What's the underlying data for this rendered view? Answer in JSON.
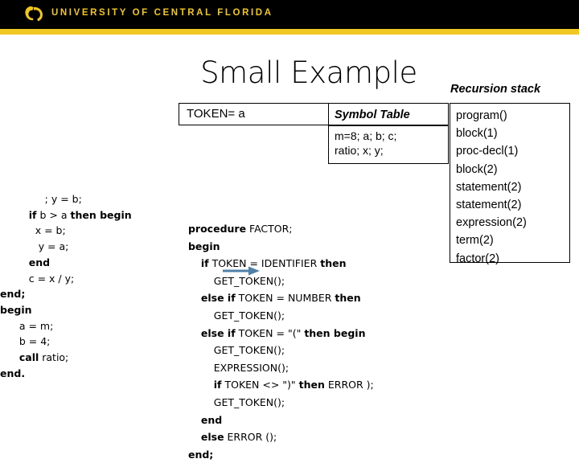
{
  "banner": {
    "brand_text": "UNIVERSITY OF CENTRAL FLORIDA",
    "logo_icon": "ucf-pegasus-icon",
    "bg_color": "#000000",
    "gold_color": "#efc822"
  },
  "slide": {
    "title": "Small Example"
  },
  "token_box": {
    "label": "TOKEN= a"
  },
  "symbol_table": {
    "header": "Symbol Table",
    "rows": [
      "m=8; a; b; c;",
      "ratio; x; y;"
    ]
  },
  "recursion_stack": {
    "label": "Recursion stack",
    "frames": [
      "program()",
      "block(1)",
      "proc-decl(1)",
      "block(2)",
      "statement(2)",
      "statement(2)",
      "expression(2)",
      "term(2)",
      "factor(2)"
    ]
  },
  "source_code": {
    "lines": [
      {
        "indent": 14,
        "parts": [
          {
            "t": "; y = b;",
            "kw": false
          }
        ]
      },
      {
        "indent": 9,
        "parts": [
          {
            "t": "if",
            "kw": true
          },
          {
            "t": " b > a ",
            "kw": false
          },
          {
            "t": "then begin",
            "kw": true
          }
        ]
      },
      {
        "indent": 11,
        "parts": [
          {
            "t": "x = b;",
            "kw": false
          }
        ]
      },
      {
        "indent": 12,
        "parts": [
          {
            "t": "y = a;",
            "kw": false
          }
        ]
      },
      {
        "indent": 9,
        "parts": [
          {
            "t": "end",
            "kw": true
          }
        ]
      },
      {
        "indent": 9,
        "parts": [
          {
            "t": "c = x / y;",
            "kw": false
          }
        ]
      },
      {
        "indent": 0,
        "parts": [
          {
            "t": "end;",
            "kw": true
          }
        ]
      },
      {
        "indent": 0,
        "parts": [
          {
            "t": "begin",
            "kw": true
          }
        ]
      },
      {
        "indent": 6,
        "parts": [
          {
            "t": "a = m;",
            "kw": false
          }
        ]
      },
      {
        "indent": 6,
        "parts": [
          {
            "t": "b = 4;",
            "kw": false
          }
        ]
      },
      {
        "indent": 6,
        "parts": [
          {
            "t": "call",
            "kw": true
          },
          {
            "t": " ratio;",
            "kw": false
          }
        ]
      },
      {
        "indent": 0,
        "parts": [
          {
            "t": "end.",
            "kw": true
          }
        ]
      }
    ]
  },
  "factor_code": {
    "lines": [
      {
        "indent": 1,
        "parts": [
          {
            "t": "procedure",
            "kw": true
          },
          {
            "t": " FACTOR;",
            "kw": false
          }
        ]
      },
      {
        "indent": 1,
        "parts": [
          {
            "t": "begin",
            "kw": true
          }
        ]
      },
      {
        "indent": 5,
        "parts": [
          {
            "t": "if",
            "kw": true
          },
          {
            "t": " TOKEN = IDENTIFIER ",
            "kw": false
          },
          {
            "t": "then",
            "kw": true
          }
        ]
      },
      {
        "indent": 9,
        "parts": [
          {
            "t": "GET_TOKEN();",
            "kw": false
          }
        ]
      },
      {
        "indent": 5,
        "parts": [
          {
            "t": "else if",
            "kw": true
          },
          {
            "t": " TOKEN = NUMBER ",
            "kw": false
          },
          {
            "t": "then",
            "kw": true
          }
        ]
      },
      {
        "indent": 9,
        "parts": [
          {
            "t": "GET_TOKEN();",
            "kw": false
          }
        ]
      },
      {
        "indent": 5,
        "parts": [
          {
            "t": "else if",
            "kw": true
          },
          {
            "t": " TOKEN = \"(\" ",
            "kw": false
          },
          {
            "t": "then begin",
            "kw": true
          }
        ]
      },
      {
        "indent": 9,
        "parts": [
          {
            "t": "GET_TOKEN();",
            "kw": false
          }
        ]
      },
      {
        "indent": 9,
        "parts": [
          {
            "t": "EXPRESSION();",
            "kw": false
          }
        ]
      },
      {
        "indent": 9,
        "parts": [
          {
            "t": "if",
            "kw": true
          },
          {
            "t": " TOKEN <> \")\" ",
            "kw": false
          },
          {
            "t": "then",
            "kw": true
          },
          {
            "t": " ERROR );",
            "kw": false
          }
        ]
      },
      {
        "indent": 9,
        "parts": [
          {
            "t": "GET_TOKEN();",
            "kw": false
          }
        ]
      },
      {
        "indent": 5,
        "parts": [
          {
            "t": "end",
            "kw": true
          }
        ]
      },
      {
        "indent": 5,
        "parts": [
          {
            "t": "else",
            "kw": true
          },
          {
            "t": " ERROR ();",
            "kw": false
          }
        ]
      },
      {
        "indent": 1,
        "parts": [
          {
            "t": "end;",
            "kw": true
          }
        ]
      }
    ]
  },
  "pointer_arrow": {
    "icon": "right-arrow-icon",
    "color": "#4f81a8",
    "points_to_line": "GET_TOKEN();"
  }
}
